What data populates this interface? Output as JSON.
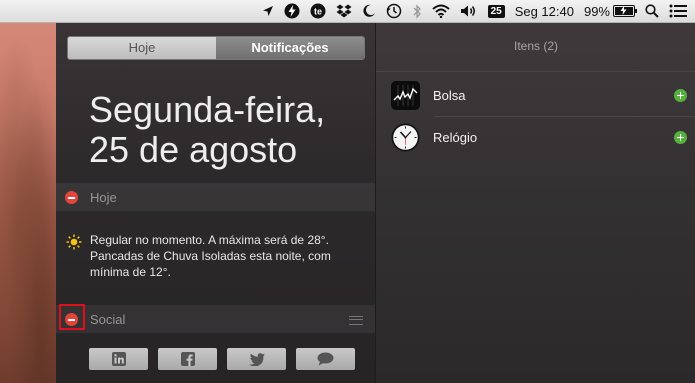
{
  "menubar": {
    "calendar_day": "25",
    "clock": "Seg 12:40",
    "battery_percent": "99%",
    "battery_level": 0.99
  },
  "notification_center": {
    "tabs": [
      {
        "label": "Hoje",
        "active": false
      },
      {
        "label": "Notificações",
        "active": true
      }
    ],
    "date_line1": "Segunda-feira,",
    "date_line2": "25 de agosto",
    "sections": {
      "today": {
        "title": "Hoje",
        "weather_text": "Regular no momento. A máxima será de 28°. Pancadas de Chuva Isoladas esta noite, com mínima de 12°."
      },
      "social": {
        "title": "Social",
        "buttons": [
          "linkedin-icon",
          "facebook-icon",
          "twitter-icon",
          "messages-icon"
        ]
      }
    }
  },
  "items_panel": {
    "title": "Itens (2)",
    "items": [
      {
        "label": "Bolsa",
        "icon": "stocks-icon"
      },
      {
        "label": "Relógio",
        "icon": "clock-icon"
      }
    ]
  },
  "colors": {
    "remove": "#e2453c",
    "add": "#56b13f",
    "highlight": "#e0101a"
  }
}
